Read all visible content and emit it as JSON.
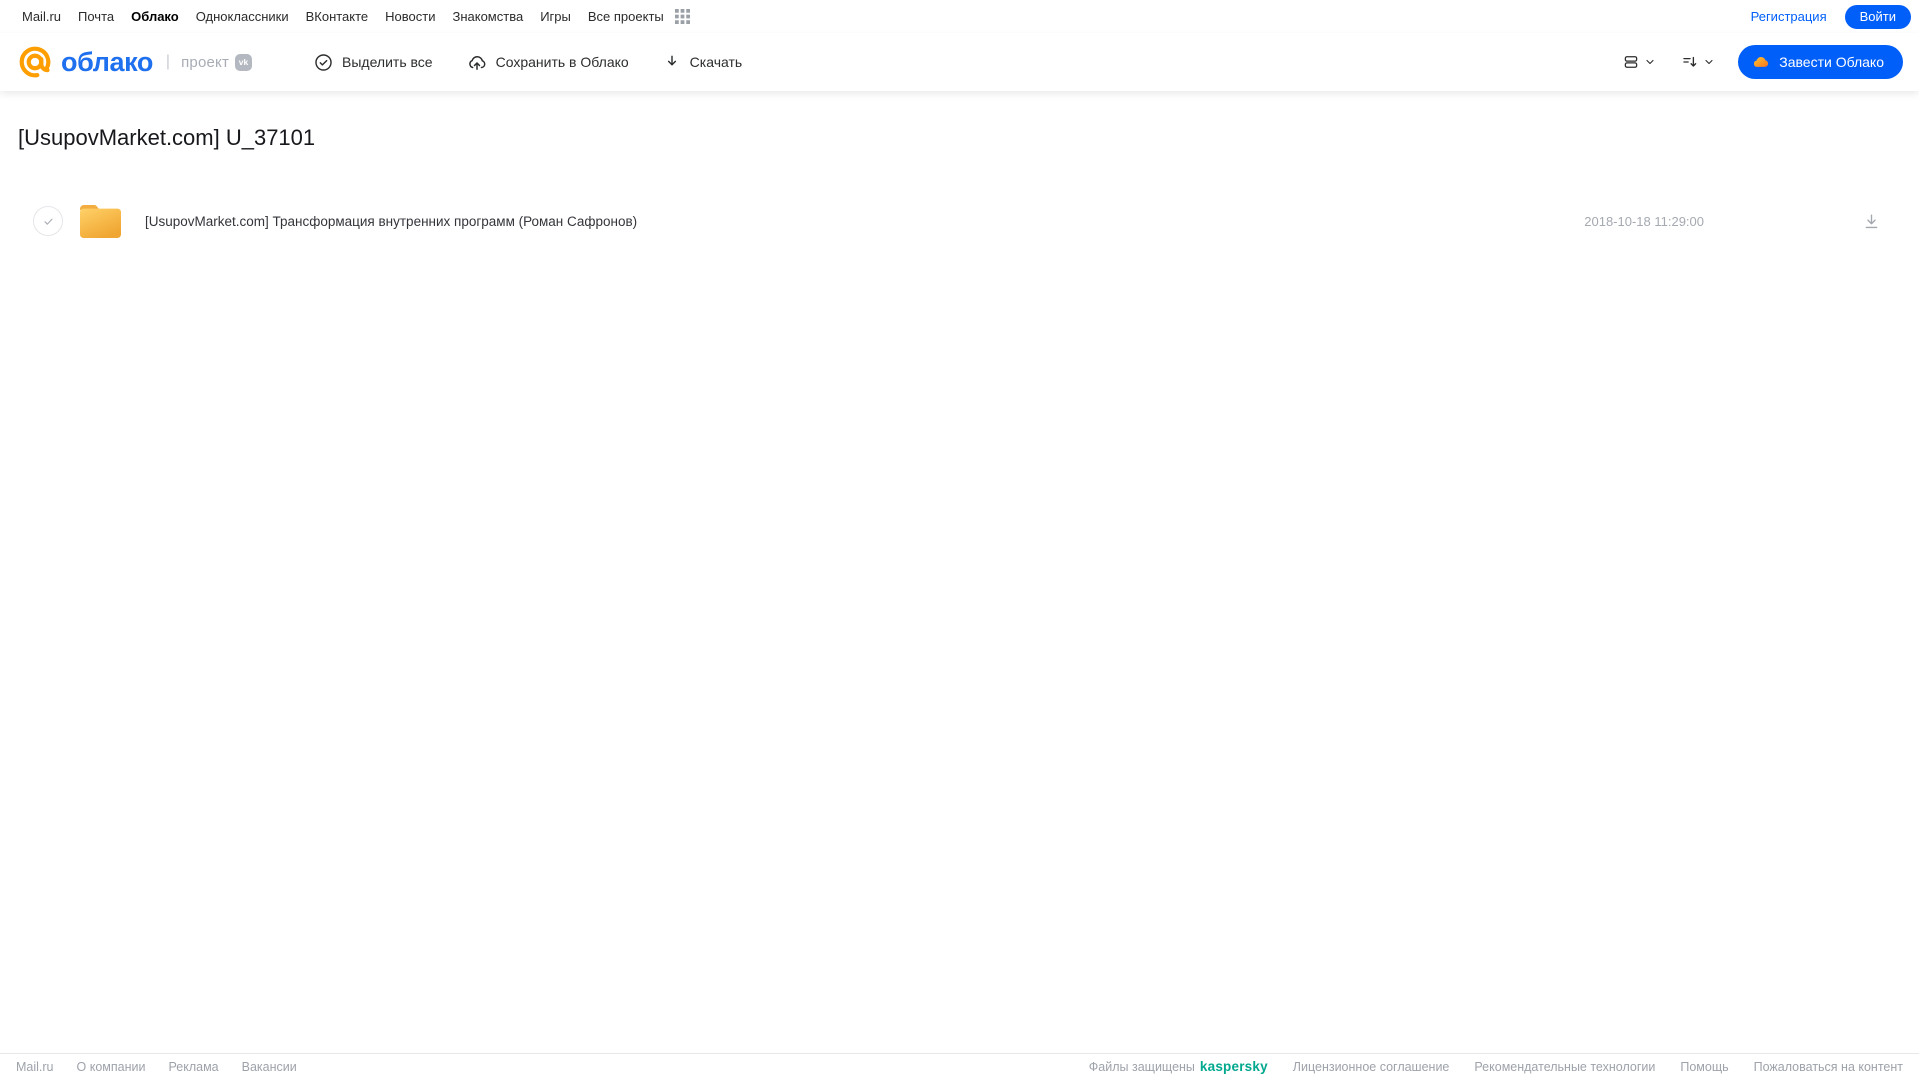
{
  "topnav": {
    "links": [
      "Mail.ru",
      "Почта",
      "Облако",
      "Одноклассники",
      "ВКонтакте",
      "Новости",
      "Знакомства",
      "Игры",
      "Все проекты"
    ],
    "active_link": "Облако",
    "auth": {
      "register": "Регистрация",
      "login": "Войти"
    }
  },
  "header": {
    "logo": {
      "text": "облако",
      "project": "проект",
      "vk_badge": "vk"
    },
    "toolbar": [
      {
        "label": "Выделить все",
        "icon": "check-circle-icon"
      },
      {
        "label": "Сохранить в Облако",
        "icon": "cloud-upload-icon"
      },
      {
        "label": "Скачать",
        "icon": "download-icon"
      }
    ],
    "view_controls": {
      "view_icon": "list-view-icon",
      "sort_icon": "sort-icon",
      "chevron": "chevron-down-icon"
    },
    "create_button": {
      "label": "Завести Облако",
      "icon": "cloud-icon"
    }
  },
  "main": {
    "title": "[UsupovMarket.com] U_37101",
    "files": [
      {
        "type": "folder",
        "name": "[UsupovMarket.com] Трансформация внутренних программ (Роман Сафронов)",
        "date": "2018-10-18 11:29:00"
      }
    ]
  },
  "footer": {
    "left_links": [
      "Mail.ru",
      "О компании",
      "Реклама",
      "Вакансии"
    ],
    "protected": {
      "text": "Файлы защищены",
      "brand": "kaspersky"
    },
    "right_links": [
      "Лицензионное соглашение",
      "Рекомендательные технологии",
      "Помощь",
      "Пожаловаться на контент"
    ]
  },
  "colors": {
    "accent_blue": "#005FF9",
    "logo_blue": "#1E70EF",
    "logo_orange": "#FF9E00",
    "folder_yellow_top": "#FFD168",
    "folder_yellow_bottom": "#F0A632",
    "kaspersky_green": "#00A88E",
    "muted_gray": "#A5A9B0"
  }
}
